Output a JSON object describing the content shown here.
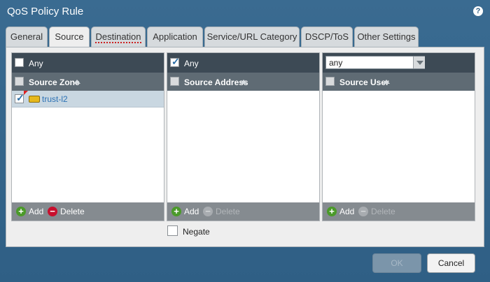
{
  "window": {
    "title": "QoS Policy Rule"
  },
  "tabs": [
    {
      "label": "General",
      "active": false
    },
    {
      "label": "Source",
      "active": true
    },
    {
      "label": "Destination",
      "active": false
    },
    {
      "label": "Application",
      "active": false
    },
    {
      "label": "Service/URL Category",
      "active": false
    },
    {
      "label": "DSCP/ToS",
      "active": false
    },
    {
      "label": "Other Settings",
      "active": false
    }
  ],
  "source_zone": {
    "any_label": "Any",
    "any_checked": false,
    "header": "Source Zone",
    "rows": [
      {
        "name": "trust-l2",
        "checked": true
      }
    ],
    "add_label": "Add",
    "delete_label": "Delete"
  },
  "source_address": {
    "any_label": "Any",
    "any_checked": true,
    "header": "Source Address",
    "rows": [],
    "add_label": "Add",
    "delete_label": "Delete"
  },
  "source_user": {
    "selected_value": "any",
    "header": "Source User",
    "rows": [],
    "add_label": "Add",
    "delete_label": "Delete"
  },
  "negate": {
    "label": "Negate",
    "checked": false
  },
  "buttons": {
    "ok_label": "OK",
    "cancel_label": "Cancel"
  },
  "colors": {
    "accent": "#2f5f85",
    "header_dark": "#3d4a55",
    "header_mid": "#5f6b74",
    "add_green": "#4b9a2a",
    "delete_red": "#c8102e"
  },
  "icons": {
    "help": "help-icon",
    "zone": "zone-icon",
    "add": "plus-circle-icon",
    "delete": "minus-circle-icon"
  }
}
